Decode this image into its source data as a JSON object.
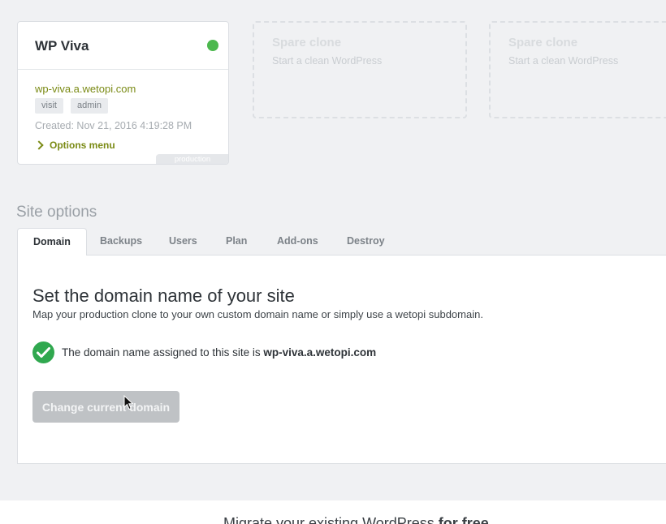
{
  "site_card": {
    "title": "WP Viva",
    "domain": "wp-viva.a.wetopi.com",
    "visit_label": "visit",
    "admin_label": "admin",
    "created": "Created: Nov 21, 2016 4:19:28 PM",
    "options_label": "Options menu",
    "env_tag": "production",
    "status_color": "#4cb84e"
  },
  "spare_clones": [
    {
      "title": "Spare clone",
      "subtitle": "Start a clean WordPress"
    },
    {
      "title": "Spare clone",
      "subtitle": "Start a clean WordPress"
    }
  ],
  "site_options": {
    "title": "Site options",
    "tabs": [
      {
        "label": "Domain",
        "active": true
      },
      {
        "label": "Backups",
        "active": false
      },
      {
        "label": "Users",
        "active": false
      },
      {
        "label": "Plan",
        "active": false
      },
      {
        "label": "Add-ons",
        "active": false
      },
      {
        "label": "Destroy",
        "active": false
      }
    ]
  },
  "domain_panel": {
    "heading": "Set the domain name of your site",
    "description": "Map your production clone to your own custom domain name or simply use a wetopi subdomain.",
    "assigned_prefix": "The domain name assigned to this site is ",
    "assigned_domain": "wp-viva.a.wetopi.com",
    "change_button": "Change current domain"
  },
  "footer": {
    "text_prefix": "Migrate your existing WordPress ",
    "text_bold": "for free"
  },
  "colors": {
    "accent_green": "#7a8a14",
    "check_green": "#30a84f"
  }
}
